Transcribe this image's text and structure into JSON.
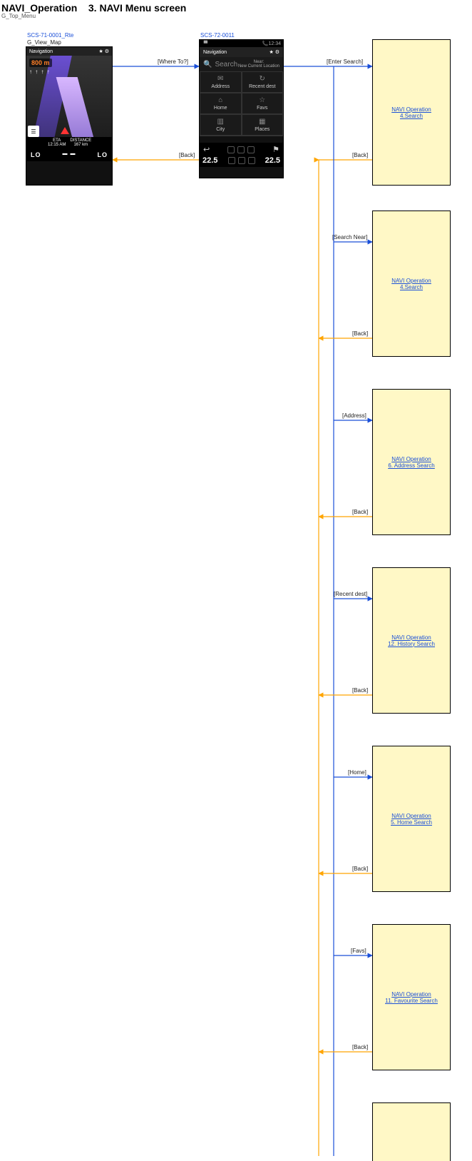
{
  "header": {
    "title": "NAVI_Operation",
    "section": "3. NAVI Menu screen",
    "subtitle": "G_Top_Menu"
  },
  "screenshot1": {
    "id": "SCS-71-0001_Rte",
    "caption": "G_View_Map",
    "topbar": "Navigation",
    "star": "★",
    "gear": "⚙",
    "distance": "800 m",
    "arrows": "↑ ↑ ↑ ↑",
    "eta": "ETA\n12:15 AM",
    "dist2": "DISTANCE\n167 km",
    "menu": "☰",
    "lo": "LO"
  },
  "screenshot2": {
    "id": "SCS-72-0011",
    "time": "12:34",
    "topbar": "Navigation",
    "star": "★",
    "gear": "⚙",
    "search_placeholder": "Search",
    "near_label": "Near:\nNew Current Location",
    "cells": {
      "address": {
        "icon": "✉",
        "label": "Address"
      },
      "recent": {
        "icon": "↻",
        "label": "Recent dest"
      },
      "home": {
        "icon": "⌂",
        "label": "Home"
      },
      "favs": {
        "icon": "☆",
        "label": "Favs"
      },
      "city": {
        "icon": "▥",
        "label": "City"
      },
      "places": {
        "icon": "▦",
        "label": "Places"
      }
    },
    "back_icon": "↩",
    "temp": "22.5"
  },
  "flows": {
    "where_to": "[Where To?]",
    "back": "[Back]",
    "enter_search": "[Enter Search]",
    "search_near": "[Search Near]",
    "address": "[Address]",
    "recent": "[Recent dest]",
    "home": "[Home]",
    "favs": "[Favs]"
  },
  "boxes": {
    "b1": {
      "l1": " NAVI Operation",
      "l2": "4.Search"
    },
    "b2": {
      "l1": " NAVI Operation",
      "l2": "4.Search"
    },
    "b3": {
      "l1": " NAVI Operation",
      "l2": "6. Address Search"
    },
    "b4": {
      "l1": "NAVI Operation",
      "l2": "12. History Search"
    },
    "b5": {
      "l1": " NAVI Operation",
      "l2": "5. Home Search"
    },
    "b6": {
      "l1": "NAVI Operation",
      "l2": "11. Favourite Search"
    }
  }
}
